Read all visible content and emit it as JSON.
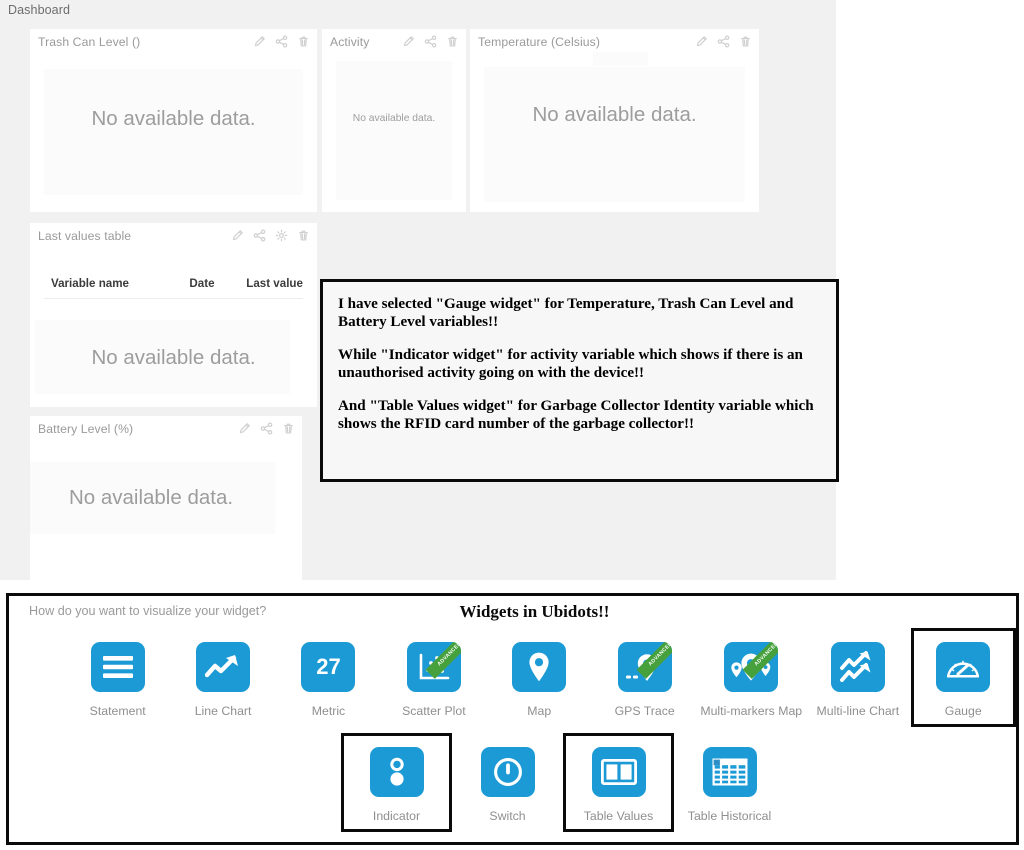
{
  "theme": {
    "brand_blue": "#1b9ad6",
    "ribbon_green": "#46a03c",
    "page_bg": "#ffffff",
    "dashboard_bg": "#f1f1f1",
    "card_bg": "#ffffff",
    "muted_text": "#9a9a9a",
    "callout_border": "#0a0a0a"
  },
  "dashboard": {
    "title": "Dashboard",
    "empty_message": "No available data.",
    "widgets": [
      {
        "name": "trash-can-level",
        "title": "Trash Can Level ()",
        "empty_message": "No available data.",
        "icons": [
          "pencil-icon",
          "share-icon",
          "trash-icon"
        ]
      },
      {
        "name": "activity",
        "title": "Activity",
        "empty_message": "No available data.",
        "icons": [
          "pencil-icon",
          "share-icon",
          "trash-icon"
        ]
      },
      {
        "name": "temperature",
        "title": "Temperature (Celsius)",
        "empty_message": "No available data.",
        "icons": [
          "pencil-icon",
          "share-icon",
          "trash-icon"
        ]
      },
      {
        "name": "last-values-table",
        "title": "Last values table",
        "empty_message": "No available data.",
        "icons": [
          "pencil-icon",
          "share-icon",
          "gear-icon",
          "trash-icon"
        ],
        "columns": [
          "Variable name",
          "Date",
          "Last value"
        ]
      },
      {
        "name": "battery-level",
        "title": "Battery Level (%)",
        "empty_message": "No available data.",
        "icons": [
          "pencil-icon",
          "share-icon",
          "trash-icon"
        ]
      }
    ]
  },
  "annotation": {
    "paragraphs": [
      "I have selected \"Gauge widget\" for Temperature, Trash Can Level and Battery Level variables!!",
      "While \"Indicator widget\" for activity variable which shows if there is an unauthorised activity going on with the device!!",
      "And \"Table Values widget\" for Garbage Collector Identity variable which shows the RFID card number of the garbage collector!!"
    ]
  },
  "picker": {
    "question": "How do you want to visualize your widget?",
    "heading": "Widgets in Ubidots!!",
    "metric_value": "27",
    "advanced_badge": "ADVANCED",
    "row1": [
      {
        "label": "Statement",
        "icon": "statement-icon",
        "advanced": false,
        "selected": false
      },
      {
        "label": "Line Chart",
        "icon": "line-chart-icon",
        "advanced": false,
        "selected": false
      },
      {
        "label": "Metric",
        "icon": "metric-icon",
        "advanced": false,
        "selected": false
      },
      {
        "label": "Scatter Plot",
        "icon": "scatter-plot-icon",
        "advanced": true,
        "selected": false
      },
      {
        "label": "Map",
        "icon": "map-pin-icon",
        "advanced": false,
        "selected": false
      },
      {
        "label": "GPS Trace",
        "icon": "gps-trace-icon",
        "advanced": true,
        "selected": false
      },
      {
        "label": "Multi-markers Map",
        "icon": "multi-markers-map-icon",
        "advanced": true,
        "selected": false
      },
      {
        "label": "Multi-line Chart",
        "icon": "multi-line-chart-icon",
        "advanced": false,
        "selected": false
      },
      {
        "label": "Gauge",
        "icon": "gauge-icon",
        "advanced": false,
        "selected": true
      }
    ],
    "row2": [
      {
        "label": "Indicator",
        "icon": "indicator-icon",
        "advanced": false,
        "selected": true
      },
      {
        "label": "Switch",
        "icon": "switch-icon",
        "advanced": false,
        "selected": false
      },
      {
        "label": "Table Values",
        "icon": "table-values-icon",
        "advanced": false,
        "selected": true
      },
      {
        "label": "Table Historical",
        "icon": "table-historical-icon",
        "advanced": false,
        "selected": false
      }
    ]
  }
}
